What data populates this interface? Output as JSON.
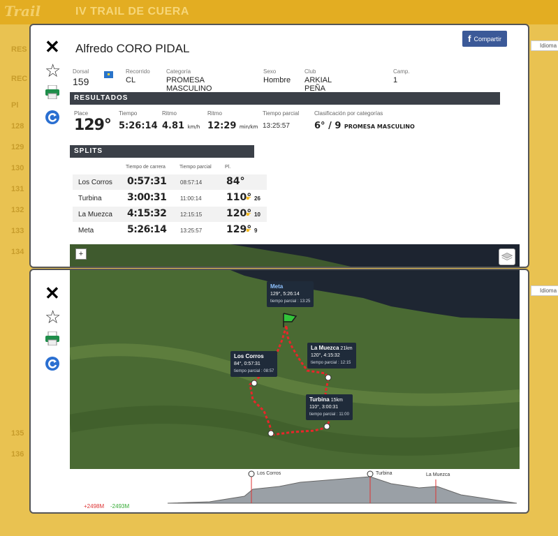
{
  "app": {
    "logo": "Trail",
    "title": "IV TRAIL DE CUERA"
  },
  "background": {
    "row_labels": [
      "RES",
      "REC",
      "Pl",
      "128",
      "129",
      "130",
      "131",
      "132",
      "133",
      "134",
      "135",
      "136"
    ]
  },
  "share": {
    "label": "Compartir",
    "icon": "facebook-icon"
  },
  "idioma": "Idioma",
  "runner": {
    "name": "Alfredo CORO PIDAL",
    "fields": [
      {
        "label": "Dorsal",
        "value": "159"
      },
      {
        "label": "Recorrido",
        "value": "CL"
      },
      {
        "label": "Categoría",
        "value": "PROMESA MASCULINO"
      },
      {
        "label": "Sexo",
        "value": "Hombre"
      },
      {
        "label": "Club",
        "value": "ARKIAL PEÑA SANTA"
      },
      {
        "label": "Camp.",
        "value": "1"
      }
    ]
  },
  "results": {
    "title": "RESULTADOS",
    "place_label": "Place",
    "place": "129°",
    "time_label": "Tiempo",
    "time": "5:26:14",
    "pace1_label": "Ritmo",
    "pace1": "4.81",
    "pace1_unit": "km/h",
    "pace2_label": "Ritmo",
    "pace2": "12:29",
    "pace2_unit": "min/km",
    "partial_label": "Tiempo parcial",
    "partial": "13:25:57",
    "cat_label": "Clasificación por categorías",
    "cat_value": "6° / 9",
    "cat_name": "PROMESA MASCULINO"
  },
  "splits": {
    "title": "SPLITS",
    "headers": [
      "Tiempo de carrera",
      "Tiempo parcial",
      "Pl."
    ],
    "rows": [
      {
        "name": "Los Corros",
        "time": "0:57:31",
        "partial": "08:57:14",
        "pl": "84°",
        "rank": ""
      },
      {
        "name": "Turbina",
        "time": "3:00:31",
        "partial": "11:00:14",
        "pl": "110°",
        "rank": "26"
      },
      {
        "name": "La Muezca",
        "time": "4:15:32",
        "partial": "12:15:15",
        "pl": "120°",
        "rank": "10"
      },
      {
        "name": "Meta",
        "time": "5:26:14",
        "partial": "13:25:57",
        "pl": "129°",
        "rank": "9"
      }
    ]
  },
  "map": {
    "zoom_in": "+",
    "zoom_out": "−",
    "callouts": [
      {
        "title": "Meta",
        "line": "129°, 5:26:14",
        "sub": "tiempo parcial : 13:25"
      },
      {
        "title": "Los Corros",
        "line": "84°, 0:57:31",
        "sub": "tiempo parcial : 08:57"
      },
      {
        "title": "La Muezca",
        "km": "21km",
        "line": "120°, 4:15:32",
        "sub": "tiempo parcial : 12:15"
      },
      {
        "title": "Turbina",
        "km": "15km",
        "line": "110°, 3:00:31",
        "sub": "tiempo parcial : 11:00"
      }
    ]
  },
  "elevation": {
    "labels": [
      "Los Corros",
      "Turbina",
      "La Muezca"
    ],
    "up": "+2498M",
    "down": "-2493M"
  },
  "colors": {
    "accent": "#e3ad22",
    "bar": "#3b4048",
    "route": "#e8262a",
    "facebook": "#3b5998"
  }
}
